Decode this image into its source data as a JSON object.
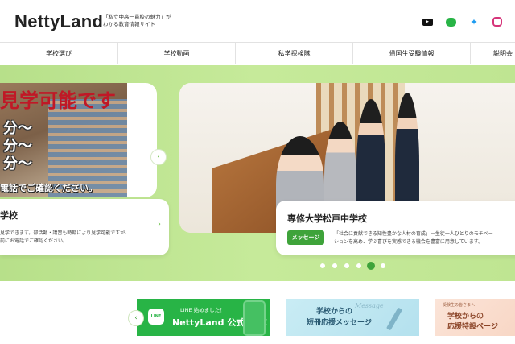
{
  "header": {
    "logo": "NettyLand",
    "tagline_line1": "「私立中高一貫校の魅力」が",
    "tagline_line2": "わかる教育情報サイト",
    "social": [
      {
        "icon": "youtube-icon",
        "color": "#111111",
        "glyph": "▶"
      },
      {
        "icon": "line-icon",
        "color": "#28b446",
        "glyph": "▬"
      },
      {
        "icon": "twitter-icon",
        "color": "#1d9bf0",
        "glyph": "✦"
      },
      {
        "icon": "instagram-icon",
        "color": "#d6357a",
        "glyph": "◎"
      }
    ]
  },
  "nav": {
    "items": [
      "学校選び",
      "学校動画",
      "私学探検隊",
      "帰国生受験情報",
      "説明会"
    ]
  },
  "hero": {
    "left_slide": {
      "red_text": "見学可能です",
      "white_1": "分〜",
      "white_2": "分〜",
      "white_3": "分〜",
      "confirm": "電話でご確認ください。",
      "card_title": "学校",
      "card_desc_1": "見学できます。部活動・講習も時期により見学可能ですが、",
      "card_desc_2": "前にお電話でご確認ください。",
      "arrow": "›"
    },
    "main_slide": {
      "title": "専修大学松戸中学校",
      "button": "メッセージ",
      "desc_1": "「社会に貢献できる知性豊かな人材の育成」－生徒一人ひとりのモチベー",
      "desc_2": "ションを高め、学ぶ喜びを実感できる機会を豊富に用意しています。"
    },
    "prev": "‹",
    "dots": {
      "count": 6,
      "active": 4
    }
  },
  "banners": {
    "prev": "‹",
    "line": {
      "icon_text": "LINE",
      "small": "LINE 始めました！",
      "main": "NettyLand 公式LINE"
    },
    "message": {
      "line1": "学校からの",
      "line2": "短冊応援メッセージ",
      "script": "Message"
    },
    "special": {
      "small": "受験生の皆さまへ",
      "line1": "学校からの",
      "line2": "応援特設ページ"
    }
  },
  "colors": {
    "accent_green": "#3ea33a",
    "hero_bg": "#c6ea9a",
    "line_green": "#28b446"
  }
}
